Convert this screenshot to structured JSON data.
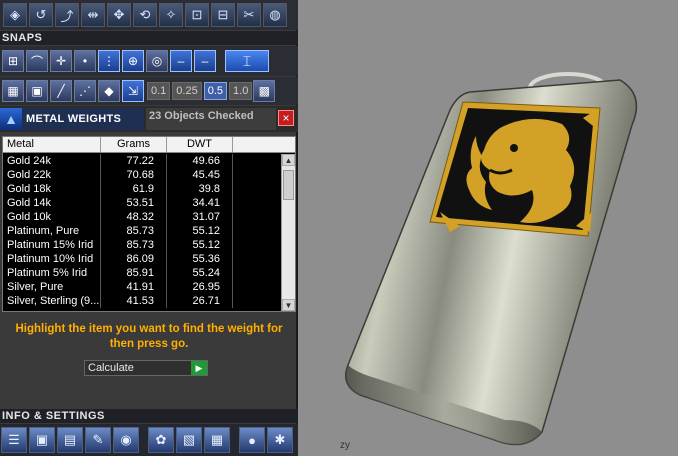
{
  "snaps": {
    "title": "SNAPS",
    "values": [
      "0.1",
      "0.25",
      "0.5",
      "1.0"
    ],
    "active_value_index": 2
  },
  "metal_weights": {
    "title": "METAL WEIGHTS",
    "objects_checked": "23 Objects Checked",
    "close_label": "×",
    "columns": [
      "Metal",
      "Grams",
      "DWT"
    ],
    "rows": [
      {
        "metal": "Gold 24k",
        "grams": "77.22",
        "dwt": "49.66"
      },
      {
        "metal": "Gold 22k",
        "grams": "70.68",
        "dwt": "45.45"
      },
      {
        "metal": "Gold 18k",
        "grams": "61.9",
        "dwt": "39.8"
      },
      {
        "metal": "Gold 14k",
        "grams": "53.51",
        "dwt": "34.41"
      },
      {
        "metal": "Gold 10k",
        "grams": "48.32",
        "dwt": "31.07"
      },
      {
        "metal": "Platinum, Pure",
        "grams": "85.73",
        "dwt": "55.12"
      },
      {
        "metal": "Platinum 15% Irid",
        "grams": "85.73",
        "dwt": "55.12"
      },
      {
        "metal": "Platinum 10% Irid",
        "grams": "86.09",
        "dwt": "55.36"
      },
      {
        "metal": "Platinum 5% Irid",
        "grams": "85.91",
        "dwt": "55.24"
      },
      {
        "metal": "Silver, Pure",
        "grams": "41.91",
        "dwt": "26.95"
      },
      {
        "metal": "Silver, Sterling (9...",
        "grams": "41.53",
        "dwt": "26.71"
      }
    ],
    "instruction": "Highlight the item you want to find the weight for then press go.",
    "calculate_label": "Calculate",
    "go_label": "▶"
  },
  "info_settings": {
    "title": "INFO & SETTINGS"
  },
  "viewport": {
    "axis_label": "zy"
  },
  "colors": {
    "accent_orange": "#ffb000",
    "panel_bg": "#3a3a3a",
    "viewport_bg": "#8e8e8e",
    "title_bg": "#1e2f52",
    "close_red": "#c21e1e",
    "go_green": "#1e9a36",
    "pendant_gold": "#d2a126"
  },
  "icons": {
    "toolbar": [
      "cube-icon",
      "curve-icon",
      "dotted-curve-icon",
      "mirror-icon",
      "move-icon",
      "rotate-icon",
      "magic-icon",
      "group-icon",
      "ungroup-icon",
      "scissors-icon",
      "globe-icon"
    ],
    "snaps": [
      "grid-snap-icon",
      "curve-snap-icon",
      "cross-snap-icon",
      "point-snap-icon",
      "midpoint-snap-icon",
      "circle-snap-icon",
      "center-snap-icon",
      "line-snap-icon",
      "line-end-snap-icon",
      "ortho-snap-icon"
    ],
    "snaps_row2": [
      "grid-icon",
      "box-icon",
      "line-icon",
      "diagonal-icon",
      "eye-icon",
      "arrow-snap-icon",
      "grid-small-icon"
    ],
    "info": [
      "stack-icon",
      "box-3d-icon",
      "document-icon",
      "pencil-icon",
      "object-icon",
      "paint-icon",
      "render-icon",
      "camera-icon",
      "sphere-icon",
      "figure-icon"
    ]
  }
}
